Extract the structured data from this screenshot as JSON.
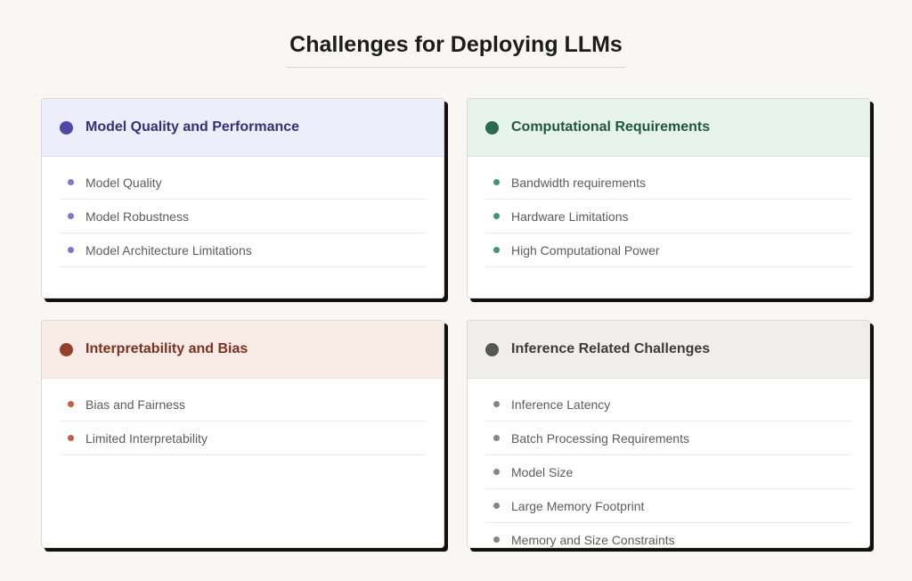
{
  "title": "Challenges for Deploying LLMs",
  "cards": [
    {
      "title": "Model Quality and Performance",
      "colors": {
        "header_bg": "#eeedfb",
        "accent": "#4b48a8",
        "title": "#33317a",
        "bullet": "#7c78cf"
      },
      "items": [
        "Model Quality",
        "Model Robustness",
        "Model Architecture Limitations"
      ]
    },
    {
      "title": "Computational Requirements",
      "colors": {
        "header_bg": "#e5f3ec",
        "accent": "#2c6a50",
        "title": "#21563f",
        "bullet": "#3f9474"
      },
      "items": [
        "Bandwidth requirements",
        "Hardware Limitations",
        "High Computational Power"
      ]
    },
    {
      "title": "Interpretability and Bias",
      "colors": {
        "header_bg": "#f8ebe6",
        "accent": "#94402a",
        "title": "#7c301f",
        "bullet": "#c1603f"
      },
      "items": [
        "Bias and Fairness",
        "Limited Interpretability"
      ]
    },
    {
      "title": "Inference Related Challenges",
      "colors": {
        "header_bg": "#f0eeea",
        "accent": "#565656",
        "title": "#3b3b3b",
        "bullet": "#858585"
      },
      "items": [
        "Inference Latency",
        "Batch Processing Requirements",
        "Model Size",
        "Large Memory Footprint",
        "Memory and Size Constraints"
      ]
    }
  ]
}
